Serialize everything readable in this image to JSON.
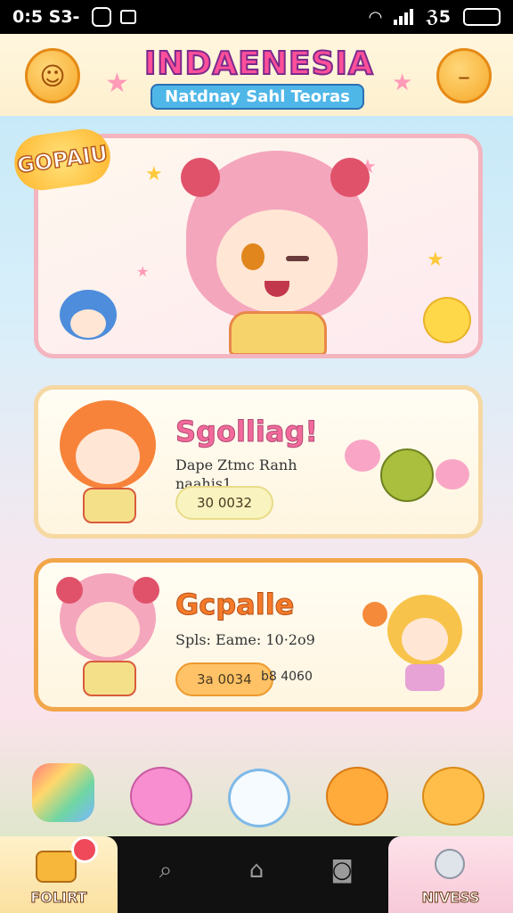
{
  "status_bar": {
    "time": "0:5 S3-",
    "network": "ℨ5"
  },
  "header": {
    "title": "INDAENESIA",
    "subtitle": "Natdnay Sahl Teoras",
    "left_icon": "paw-coin-icon",
    "right_icon": "face-icon"
  },
  "hero": {
    "badge": "GOPAIU"
  },
  "missions": [
    {
      "title": "Sgolliag!",
      "desc_line1": "Dape Ztmc Ranh",
      "desc_line2": "naahis1",
      "pill": "30 0032",
      "extra": ""
    },
    {
      "title": "Gcpalle",
      "desc_line1": "Spls: Eame: 10·2o9",
      "desc_line2": "",
      "pill": "3a 0034",
      "extra": "b8 4060"
    }
  ],
  "nav": {
    "left_label": "FOLIRT",
    "right_label": "NIVESS",
    "items": [
      "search-icon",
      "home-icon",
      "camera-icon"
    ]
  },
  "colors": {
    "accent": "#f26a9b",
    "gold": "#f5a829",
    "nav_bg": "#111111"
  }
}
